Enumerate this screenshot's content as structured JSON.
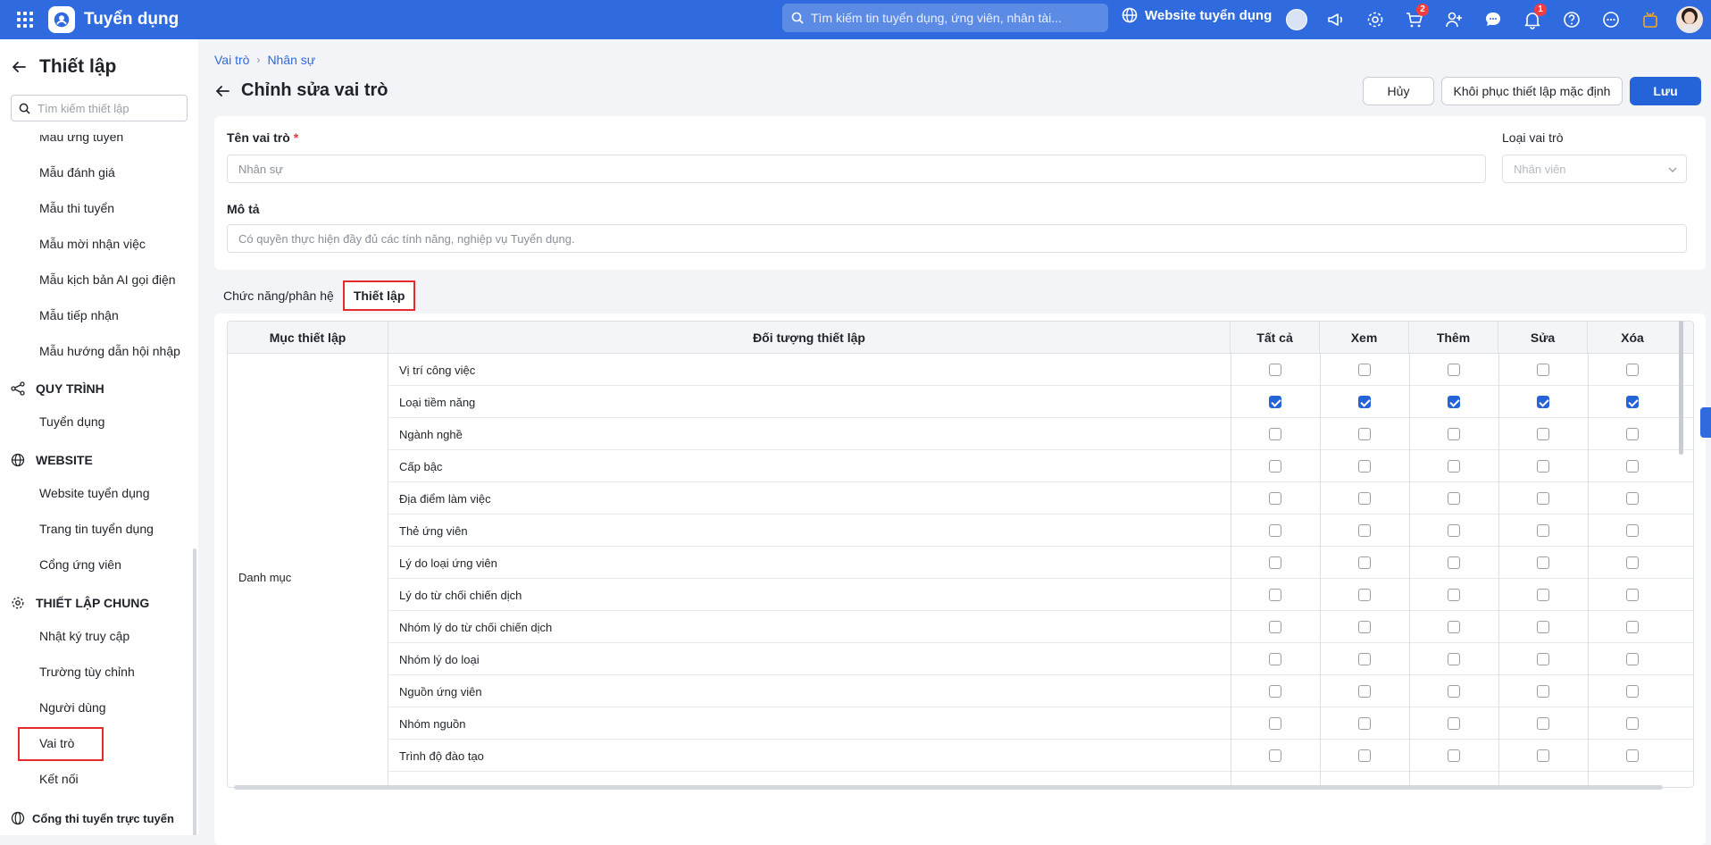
{
  "topbar": {
    "app_title": "Tuyển dụng",
    "search_placeholder": "Tìm kiếm tin tuyển dụng, ứng viên, nhân tài...",
    "website_label": "Website tuyển dụng",
    "cart_badge": "2",
    "bell_badge": "1"
  },
  "sidebar": {
    "title": "Thiết lập",
    "search_placeholder": "Tìm kiếm thiết lập",
    "items_top": [
      "Mẫu ứng tuyển",
      "Mẫu đánh giá",
      "Mẫu thi tuyển",
      "Mẫu mời nhận việc",
      "Mẫu kịch bản AI gọi điện",
      "Mẫu tiếp nhận",
      "Mẫu hướng dẫn hội nhập"
    ],
    "sec_quytrinh": "QUY TRÌNH",
    "items_quytrinh": [
      "Tuyển dụng"
    ],
    "sec_website": "WEBSITE",
    "items_website": [
      "Website tuyển dụng",
      "Trang tin tuyển dụng",
      "Cổng ứng viên"
    ],
    "sec_chung": "THIẾT LẬP CHUNG",
    "items_chung": [
      "Nhật ký truy cập",
      "Trường tùy chỉnh",
      "Người dùng",
      "Vai trò",
      "Kết nối"
    ],
    "sec_congthi": "Cổng thi tuyển trực tuyến"
  },
  "breadcrumb": [
    "Vai trò",
    "Nhân sự"
  ],
  "page": {
    "title": "Chỉnh sửa vai trò",
    "btn_cancel": "Hủy",
    "btn_restore": "Khôi phục thiết lập mặc định",
    "btn_save": "Lưu"
  },
  "form": {
    "role_name_label": "Tên vai trò",
    "required_mark": "*",
    "role_name_value": "Nhân sự",
    "role_type_label": "Loại vai trò",
    "role_type_value": "Nhân viên",
    "desc_label": "Mô tả",
    "desc_value": "Có quyền thực hiện đầy đủ các tính năng, nghiệp vụ Tuyển dụng."
  },
  "tabs": [
    "Chức năng/phân hệ",
    "Thiết lập"
  ],
  "table": {
    "headers": [
      "Mục thiết lập",
      "Đối tượng thiết lập",
      "Tất cả",
      "Xem",
      "Thêm",
      "Sửa",
      "Xóa"
    ],
    "category": "Danh mục",
    "rows": [
      {
        "name": "Vị trí công việc",
        "checks": [
          false,
          false,
          false,
          false,
          false
        ]
      },
      {
        "name": "Loại tiềm năng",
        "checks": [
          true,
          true,
          true,
          true,
          true
        ]
      },
      {
        "name": "Ngành nghề",
        "checks": [
          false,
          false,
          false,
          false,
          false
        ]
      },
      {
        "name": "Cấp bậc",
        "checks": [
          false,
          false,
          false,
          false,
          false
        ]
      },
      {
        "name": "Địa điểm làm việc",
        "checks": [
          false,
          false,
          false,
          false,
          false
        ]
      },
      {
        "name": "Thẻ ứng viên",
        "checks": [
          false,
          false,
          false,
          false,
          false
        ]
      },
      {
        "name": "Lý do loại ứng viên",
        "checks": [
          false,
          false,
          false,
          false,
          false
        ]
      },
      {
        "name": "Lý do từ chối chiến dịch",
        "checks": [
          false,
          false,
          false,
          false,
          false
        ]
      },
      {
        "name": "Nhóm lý do từ chối chiến dịch",
        "checks": [
          false,
          false,
          false,
          false,
          false
        ]
      },
      {
        "name": "Nhóm lý do loại",
        "checks": [
          false,
          false,
          false,
          false,
          false
        ]
      },
      {
        "name": "Nguồn ứng viên",
        "checks": [
          false,
          false,
          false,
          false,
          false
        ]
      },
      {
        "name": "Nhóm nguồn",
        "checks": [
          false,
          false,
          false,
          false,
          false
        ]
      },
      {
        "name": "Trình độ đào tạo",
        "checks": [
          false,
          false,
          false,
          false,
          false
        ]
      }
    ]
  },
  "colors": {
    "brand": "#2f6bdf",
    "primary": "#2563d9",
    "highlight": "#e52b2b"
  }
}
